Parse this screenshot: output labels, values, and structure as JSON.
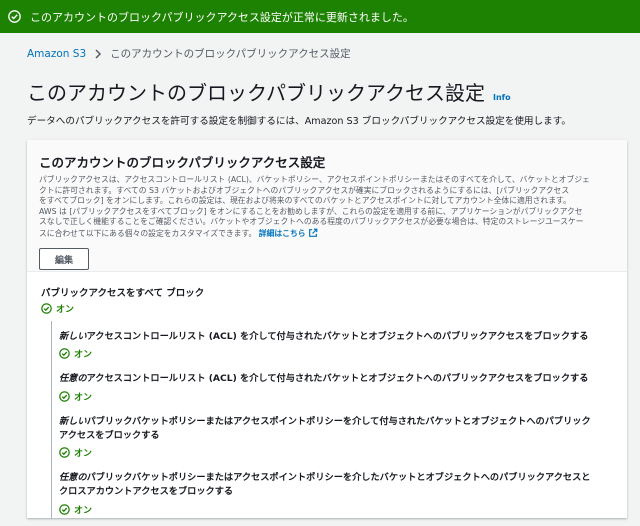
{
  "flash": {
    "message": "このアカウントのブロックパブリックアクセス設定が正常に更新されました。",
    "color": "#1d8102"
  },
  "breadcrumb": {
    "root": "Amazon S3",
    "current": "このアカウントのブロックパブリックアクセス設定"
  },
  "page": {
    "title": "このアカウントのブロックパブリックアクセス設定",
    "info": "Info",
    "description": "データへのパブリックアクセスを許可する設定を制御するには、Amazon S3 ブロックパブリックアクセス設定を使用します。"
  },
  "card": {
    "title": "このアカウントのブロックパブリックアクセス設定",
    "lines": [
      "パブリックアクセスは、アクセスコントロールリスト (ACL)、バケットポリシー、アクセスポイントポリシーまたはそのすべてを介して、バケットとオブジェ",
      "クトに許可されます。すべての S3 バケットおよびオブジェクトへのパブリックアクセスが確実にブロックされるようにするには、[パブリックアクセス",
      "をすべてブロック] をオンにします。これらの設定は、現在および将来のすべてのバケットとアクセスポイントに対してアカウント全体に適用されます。",
      "AWS は [パブリックアクセスをすべてブロック] をオンにすることをお勧めしますが、これらの設定を適用する前に、アプリケーションがパブリックアクセ",
      "スなしで正しく機能することをご確認ください。バケットやオブジェクトへのある程度のパブリックアクセスが必要な場合は、特定のストレージユースケー"
    ],
    "last_line": "スに合わせて以下にある個々の設定をカスタマイズできます。",
    "more_link": "詳細はこちら",
    "edit_button": "編集"
  },
  "settings": {
    "main": {
      "label": "パブリックアクセスをすべて ブロック",
      "status": "オン"
    },
    "items": [
      {
        "em": "新しい",
        "rest": "アクセスコントロールリスト (ACL) を介して付与されたバケットとオブジェクトへのパブリックアクセスをブロックする",
        "rest2": "",
        "status": "オン"
      },
      {
        "em": "任意の",
        "rest": "アクセスコントロールリスト (ACL) を介して付与されたバケットとオブジェクトへのパブリックアクセスをブロックする",
        "rest2": "",
        "status": "オン"
      },
      {
        "em": "新しい",
        "rest": "パブリックバケットポリシーまたはアクセスポイントポリシーを介して付与されたバケットとオブジェクトへのパブリック",
        "rest2": "アクセスをブロックする",
        "status": "オン"
      },
      {
        "em": "任意の",
        "rest": "パブリックバケットポリシーまたはアクセスポイントポリシーを介したバケットとオブジェクトへのパブリックアクセスと",
        "rest2": "クロスアカウントアクセスをブロックする",
        "status": "オン"
      }
    ]
  },
  "colors": {
    "success": "#1d8102",
    "link": "#0073bb"
  }
}
